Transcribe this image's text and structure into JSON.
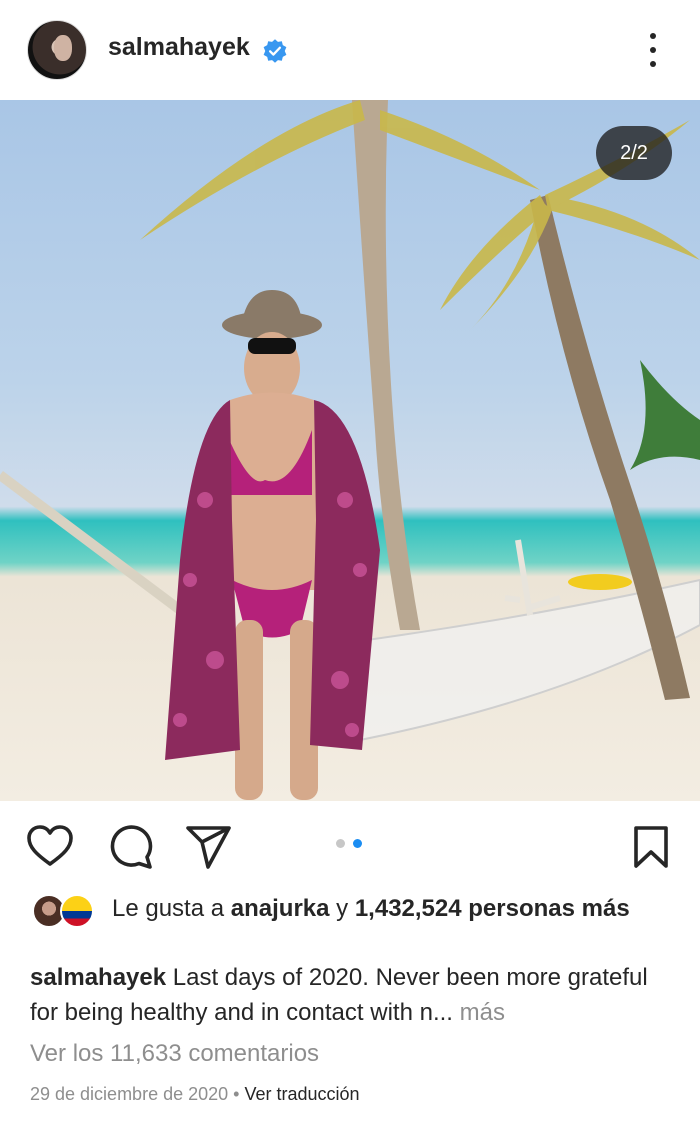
{
  "post": {
    "username": "salmahayek",
    "slide_counter": "2/2",
    "likes": {
      "prefix": "Le gusta a ",
      "user": "anajurka",
      "connector": " y ",
      "count_text": "1,432,524 personas más"
    },
    "caption": {
      "username": "salmahayek",
      "text": " Last days of 2020. Never been more grateful for being  healthy and in contact with n",
      "ellipsis": "...",
      "more": " más"
    },
    "comments_link": "Ver los 11,633 comentarios",
    "date": "29 de diciembre de 2020",
    "separator": " • ",
    "translate_link": "Ver traducción"
  },
  "carousel": {
    "total": 2,
    "active_index": 1
  },
  "icons": {
    "verified": "verified-badge-icon",
    "more": "more-options-icon",
    "like": "heart-icon",
    "comment": "comment-icon",
    "share": "send-icon",
    "save": "bookmark-icon"
  },
  "colors": {
    "accent": "#1b8df2",
    "verified": "#3897f0",
    "text": "#262626",
    "muted": "#8e8e8e"
  }
}
